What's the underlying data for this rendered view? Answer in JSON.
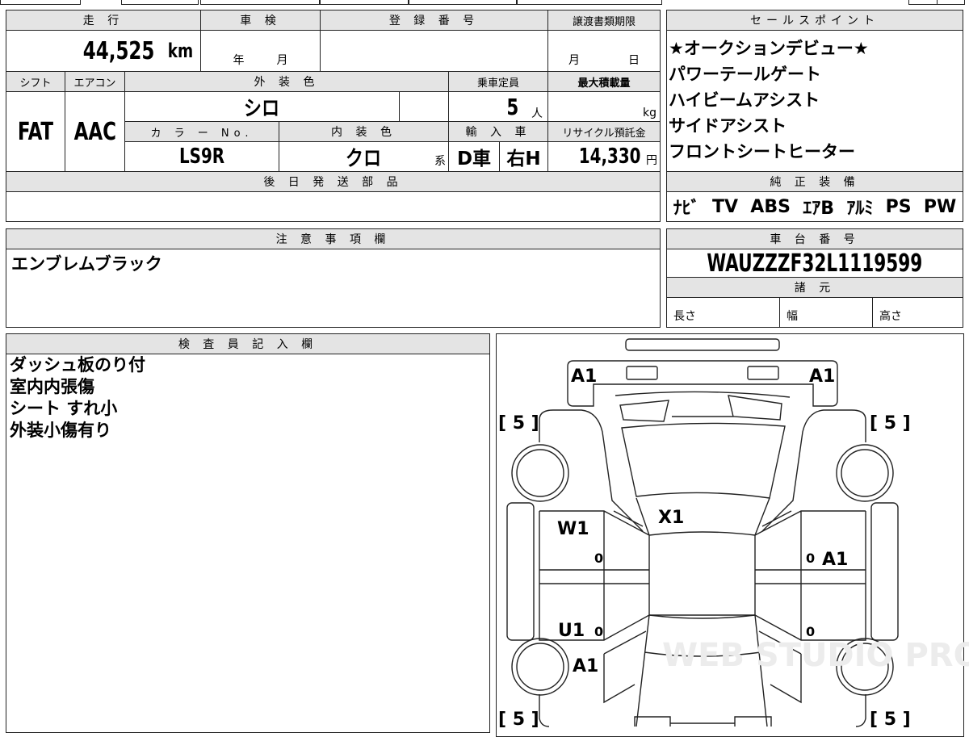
{
  "table": {
    "mileage_label": "走 行",
    "mileage_value": "44,525",
    "mileage_unit": "km",
    "inspection_label": "車 検",
    "inspection_year": "年",
    "inspection_month": "月",
    "registration_label": "登 録 番 号",
    "transfer_label": "譲渡書類期限",
    "transfer_month": "月",
    "transfer_day": "日",
    "shift_label": "シフト",
    "shift_value": "FAT",
    "ac_label": "エアコン",
    "ac_value": "AAC",
    "exterior_label": "外 装 色",
    "exterior_value": "シロ",
    "capacity_label": "乗車定員",
    "capacity_value": "5",
    "capacity_unit": "人",
    "load_label": "最大積載量",
    "load_unit": "kg",
    "color_no_label": "カ ラ ー No.",
    "color_no_value": "LS9R",
    "interior_label": "内 装 色",
    "interior_value": "クロ",
    "interior_suffix": "系",
    "import_label": "輸 入 車",
    "import_dealer": "D車",
    "import_handle": "右H",
    "recycle_label": "リサイクル預託金",
    "recycle_value": "14,330",
    "recycle_unit": "円",
    "later_parts_label": "後 日 発 送 部 品"
  },
  "sales": {
    "label": "セールスポイント",
    "items": [
      "★オークションデビュー★",
      "パワーテールゲート",
      "ハイビームアシスト",
      "サイドアシスト",
      "フロントシートヒーター"
    ]
  },
  "equipment": {
    "label": "純 正 装 備",
    "items": [
      "ﾅﾋﾞ",
      "TV",
      "ABS",
      "ｴｱB",
      "ｱﾙﾐ",
      "PS",
      "PW"
    ]
  },
  "notes": {
    "label": "注 意 事 項 欄",
    "text": "エンブレムブラック"
  },
  "chassis": {
    "label": "車 台 番 号",
    "value": "WAUZZZF32L1119599"
  },
  "specs": {
    "label": "諸 元",
    "length": "長さ",
    "width": "幅",
    "height": "高さ"
  },
  "inspector": {
    "label": "検 査 員 記 入 欄",
    "lines": [
      "ダッシュ板のり付",
      "室内内張傷",
      "シート すれ小",
      "外装小傷有り"
    ]
  },
  "diagram": {
    "marks": {
      "front_left": "A1",
      "front_right": "A1",
      "left_front_door": "W1",
      "windshield": "X1",
      "right_front_door": "A1",
      "left_rear_door": "U1",
      "left_rear_fender": "A1",
      "zero": "0",
      "tread": "[ 5 ]"
    },
    "watermark": "WEB STUDIO PRO"
  }
}
